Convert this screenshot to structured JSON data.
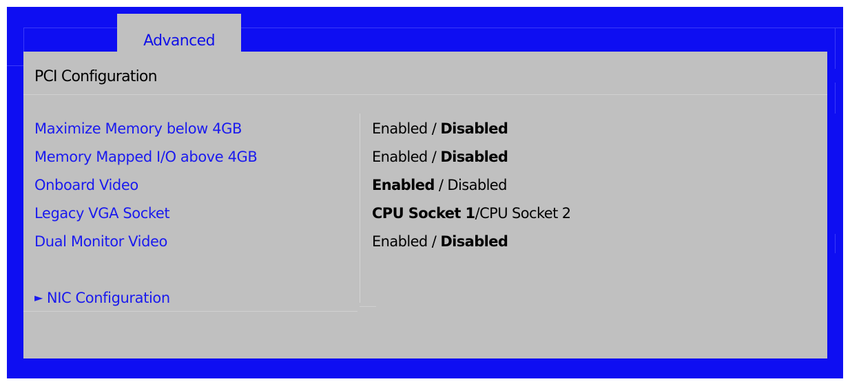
{
  "tabs": {
    "active_label": "Advanced"
  },
  "page": {
    "title": "PCI Configuration"
  },
  "settings": [
    {
      "label": "Maximize Memory below 4GB",
      "options": [
        {
          "text": "Enabled",
          "bold": false
        },
        {
          "text": " / ",
          "bold": false
        },
        {
          "text": "Disabled",
          "bold": true
        }
      ]
    },
    {
      "label": "Memory Mapped I/O above 4GB",
      "options": [
        {
          "text": "Enabled",
          "bold": false
        },
        {
          "text": " / ",
          "bold": false
        },
        {
          "text": "Disabled",
          "bold": true
        }
      ]
    },
    {
      "label": "Onboard Video",
      "options": [
        {
          "text": "Enabled",
          "bold": true
        },
        {
          "text": " / ",
          "bold": false
        },
        {
          "text": "Disabled",
          "bold": false
        }
      ]
    },
    {
      "label": "Legacy VGA Socket",
      "options": [
        {
          "text": "CPU Socket 1",
          "bold": true
        },
        {
          "text": "/",
          "bold": false
        },
        {
          "text": "CPU Socket 2",
          "bold": false
        }
      ]
    },
    {
      "label": "Dual Monitor Video",
      "options": [
        {
          "text": "Enabled",
          "bold": false
        },
        {
          "text": " / ",
          "bold": false
        },
        {
          "text": "Disabled",
          "bold": true
        }
      ]
    }
  ],
  "submenu": {
    "arrow_icon": "right-triangle-icon",
    "arrow_glyph": "►",
    "label": "NIC Configuration"
  },
  "colors": {
    "frame_blue": "#0e0ef2",
    "panel_gray": "#c0c0c0",
    "label_blue": "#1a1aee",
    "value_black": "#000000"
  }
}
